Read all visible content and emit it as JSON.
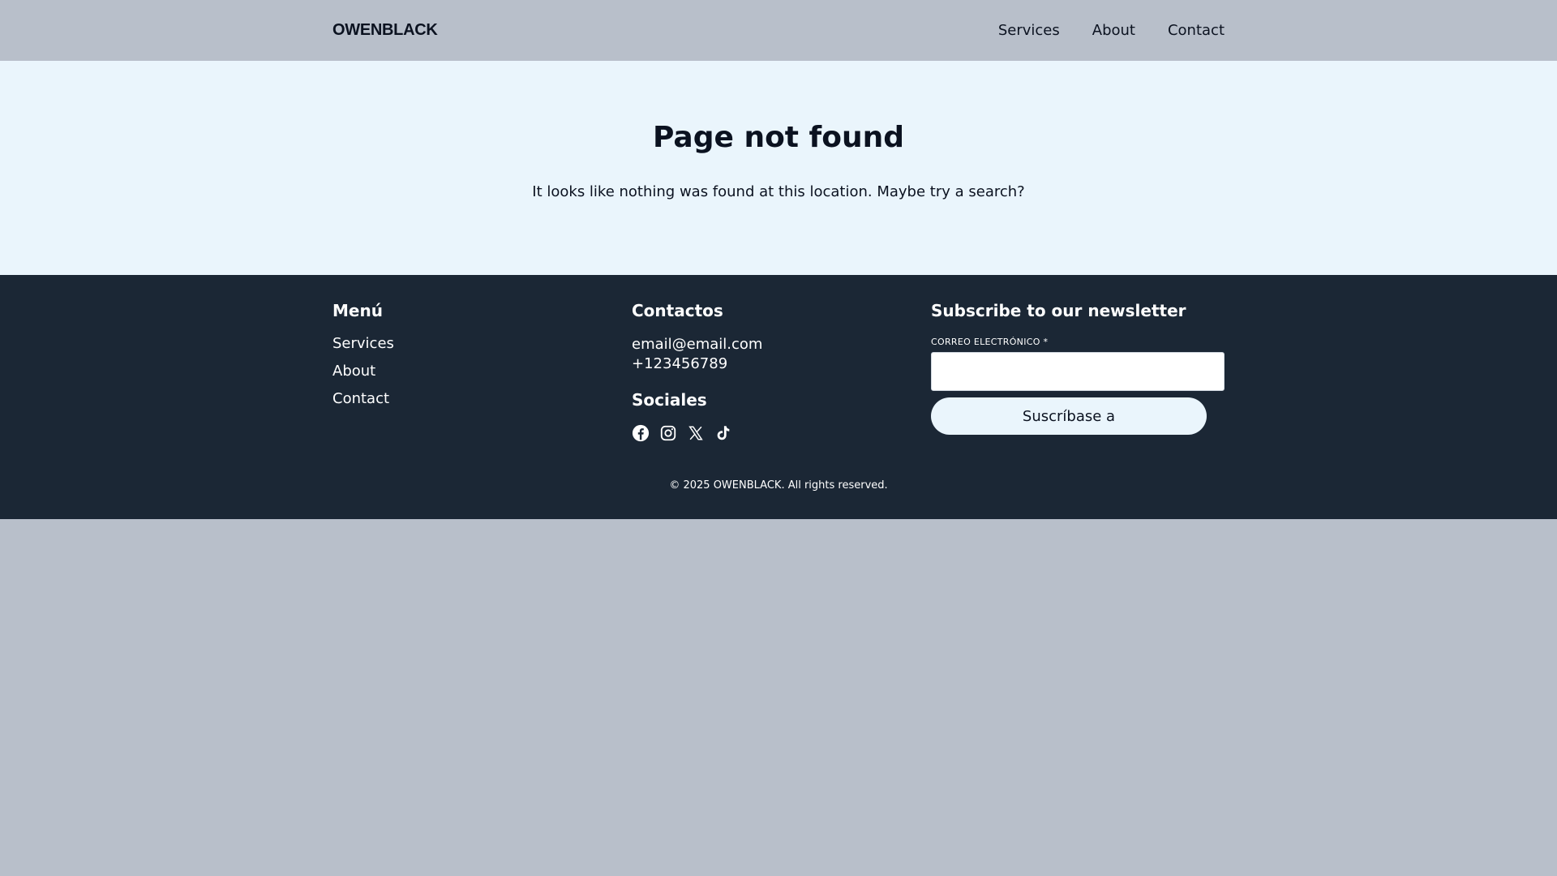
{
  "header": {
    "logo": "OWENBLACK",
    "nav": [
      {
        "label": "Services"
      },
      {
        "label": "About"
      },
      {
        "label": "Contact"
      }
    ]
  },
  "main": {
    "title": "Page not found",
    "message": "It looks like nothing was found at this location. Maybe try a search?"
  },
  "footer": {
    "menu": {
      "title": "Menú",
      "items": [
        {
          "label": "Services"
        },
        {
          "label": "About"
        },
        {
          "label": "Contact"
        }
      ]
    },
    "contacts": {
      "title": "Contactos",
      "email": "email@email.com",
      "phone": "+123456789"
    },
    "socials": {
      "title": "Sociales",
      "icons": [
        "facebook-icon",
        "instagram-icon",
        "x-icon",
        "tiktok-icon"
      ]
    },
    "newsletter": {
      "title": "Subscribe to our newsletter",
      "email_label": "CORREO ELECTRÓNICO *",
      "email_value": "",
      "button_label": "Suscríbase a"
    },
    "copyright": "© 2025 OWENBLACK. All rights reserved."
  },
  "colors": {
    "header_bg": "#b8bfca",
    "main_bg": "#eaf5fc",
    "footer_bg": "#1b2735",
    "text_dark": "#0b1220"
  }
}
